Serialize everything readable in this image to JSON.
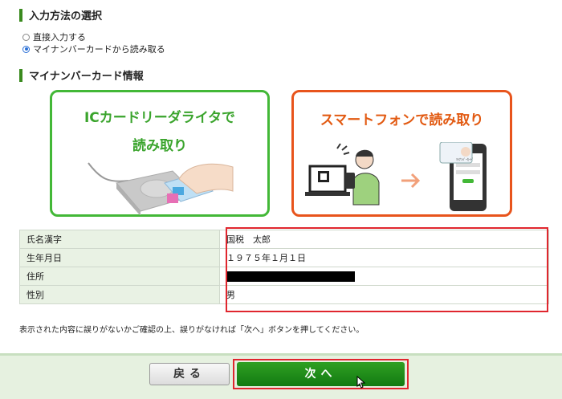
{
  "input_method": {
    "heading": "入力方法の選択",
    "options": [
      {
        "label": "直接入力する",
        "checked": false
      },
      {
        "label": "マイナンバーカードから読み取る",
        "checked": true
      }
    ]
  },
  "card_info": {
    "heading": "マイナンバーカード情報",
    "ic_card": {
      "line1": "ICカードリーダライタで",
      "line2": "読み取り"
    },
    "smartphone": {
      "title": "スマートフォンで読み取り",
      "card_label": "ﾏｲﾅﾝﾊﾞｰｶｰﾄﾞ"
    },
    "table": [
      {
        "label": "氏名漢字",
        "value": "国税　太郎"
      },
      {
        "label": "生年月日",
        "value": "１９７５年１月１日"
      },
      {
        "label": "住所",
        "value": ""
      },
      {
        "label": "性別",
        "value": "男"
      }
    ]
  },
  "note": "表示された内容に誤りがないかご確認の上、誤りがなければ「次へ」ボタンを押してください。",
  "buttons": {
    "back": "戻る",
    "next": "次へ"
  },
  "colors": {
    "green": "#3aa42c",
    "orange": "#e25a12",
    "red_highlight": "#e0262e",
    "primary_button": "#1f8c1a"
  }
}
